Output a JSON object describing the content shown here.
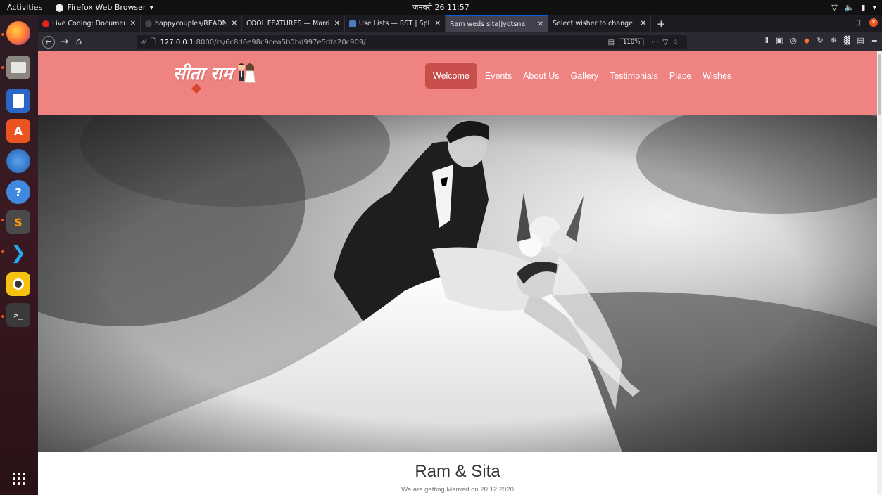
{
  "system_bar": {
    "activities": "Activities",
    "app_name": "Firefox Web Browser",
    "clock": "जनवरी 26  11:57"
  },
  "dock": {
    "items": [
      "firefox",
      "files",
      "libreoffice-writer",
      "software-center",
      "thunderbird",
      "help",
      "sublime-text",
      "vscode",
      "rhythmbox",
      "terminal"
    ]
  },
  "browser": {
    "tabs": [
      {
        "title": "Live Coding: Documenta",
        "favicon_color": "#e62117"
      },
      {
        "title": "happycouples/README.",
        "favicon_color": "#444"
      },
      {
        "title": "COOL FEATURES — Marriag",
        "favicon_color": "#1c1b22"
      },
      {
        "title": "Use Lists — RST | Sphinx",
        "favicon_color": "#4c7cc2"
      },
      {
        "title": "Ram weds sita|Jyotsna",
        "favicon_color": "#42414d"
      },
      {
        "title": "Select wisher to change | Dj",
        "favicon_color": "#1c1b22"
      }
    ],
    "new_tab": "+",
    "url_host": "127.0.0.1",
    "url_path": ":8000/rs/6c8d6e98c9cea5b0bd997e5dfa20c909/",
    "zoom": "110%"
  },
  "site": {
    "logo_text": "सीता राम",
    "nav": [
      "Welcome",
      "Events",
      "About Us",
      "Gallery",
      "Testimonials",
      "Place",
      "Wishes"
    ],
    "active_nav": "Welcome",
    "couple_names": "Ram & Sita",
    "subtitle": "We are getting Married on 20.12.2020"
  },
  "colors": {
    "header_bg": "#ef8382",
    "active_nav_bg": "#c94f4d"
  }
}
